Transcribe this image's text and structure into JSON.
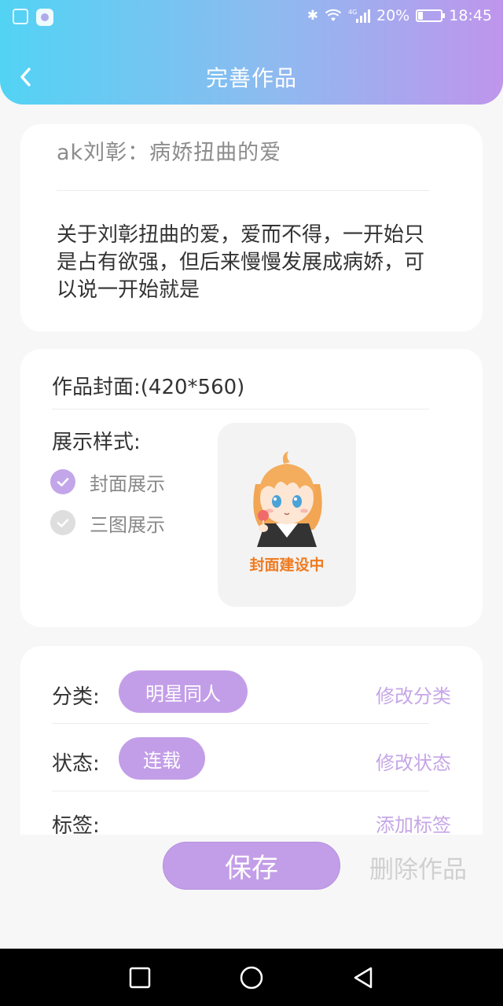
{
  "status_bar": {
    "network": "4G",
    "battery": "20%",
    "battery_level": 0.2,
    "time": "18:45"
  },
  "header": {
    "title": "完善作品",
    "back_icon": "chevron-left-icon"
  },
  "work": {
    "title": "ak刘彰：病娇扭曲的爱",
    "description": "关于刘彰扭曲的爱，爱而不得，一开始只是占有欲强，但后来慢慢发展成病娇，可以说一开始就是"
  },
  "cover": {
    "label": "作品封面:(420*560)",
    "display_label": "展示样式:",
    "options": [
      {
        "label": "封面展示",
        "checked": true
      },
      {
        "label": "三图展示",
        "checked": false
      }
    ],
    "placeholder_text": "封面建设中"
  },
  "meta": {
    "category_label": "分类:",
    "category_value": "明星同人",
    "category_action": "修改分类",
    "status_label": "状态:",
    "status_value": "连载",
    "status_action": "修改状态",
    "tags_label": "标签:",
    "tags_action": "添加标签"
  },
  "actions": {
    "save": "保存",
    "delete": "删除作品"
  },
  "colors": {
    "accent": "#c39ee8",
    "header_gradient_start": "#52d3f4",
    "header_gradient_end": "#bf95ec",
    "cover_caption": "#f07a1e"
  }
}
